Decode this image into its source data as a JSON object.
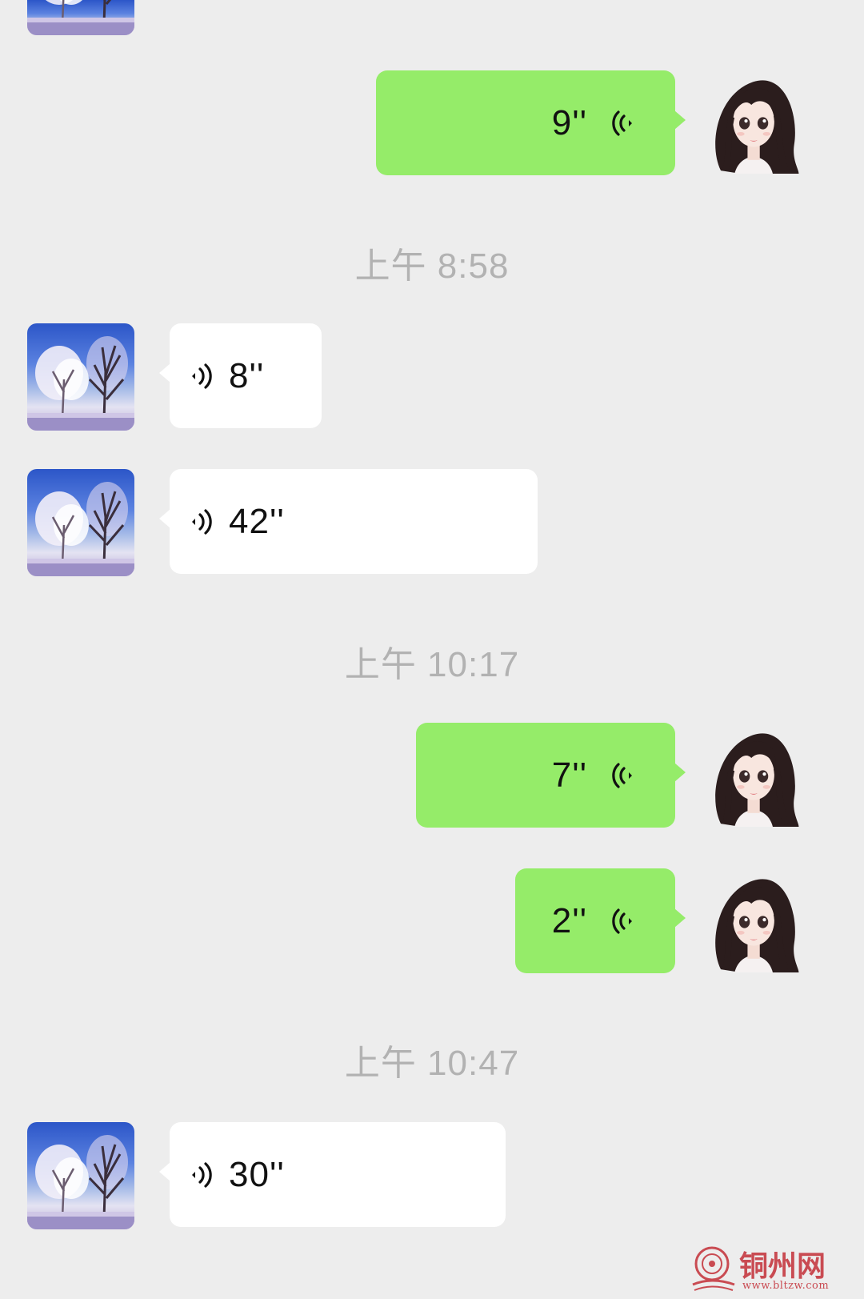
{
  "colors": {
    "background": "#ededed",
    "sent_bubble": "#95ec69",
    "received_bubble": "#ffffff",
    "timestamp": "#b2b2b2",
    "watermark": "#c94b52"
  },
  "timestamps": {
    "t1": "上午 8:58",
    "t2": "上午 10:17",
    "t3": "上午 10:47"
  },
  "messages": {
    "m1": {
      "direction": "sent",
      "type": "voice",
      "duration": "9''"
    },
    "m2": {
      "direction": "received",
      "type": "voice",
      "duration": "8''"
    },
    "m3": {
      "direction": "received",
      "type": "voice",
      "duration": "42''"
    },
    "m4": {
      "direction": "sent",
      "type": "voice",
      "duration": "7''"
    },
    "m5": {
      "direction": "sent",
      "type": "voice",
      "duration": "2''"
    },
    "m6": {
      "direction": "received",
      "type": "voice",
      "duration": "30''"
    }
  },
  "icons": {
    "voice": "voice-wave-icon",
    "contact_avatar": "winter-tree-avatar",
    "self_avatar": "cartoon-girl-avatar"
  },
  "watermark": {
    "name": "铜州网",
    "url": "www.bltzw.com"
  }
}
